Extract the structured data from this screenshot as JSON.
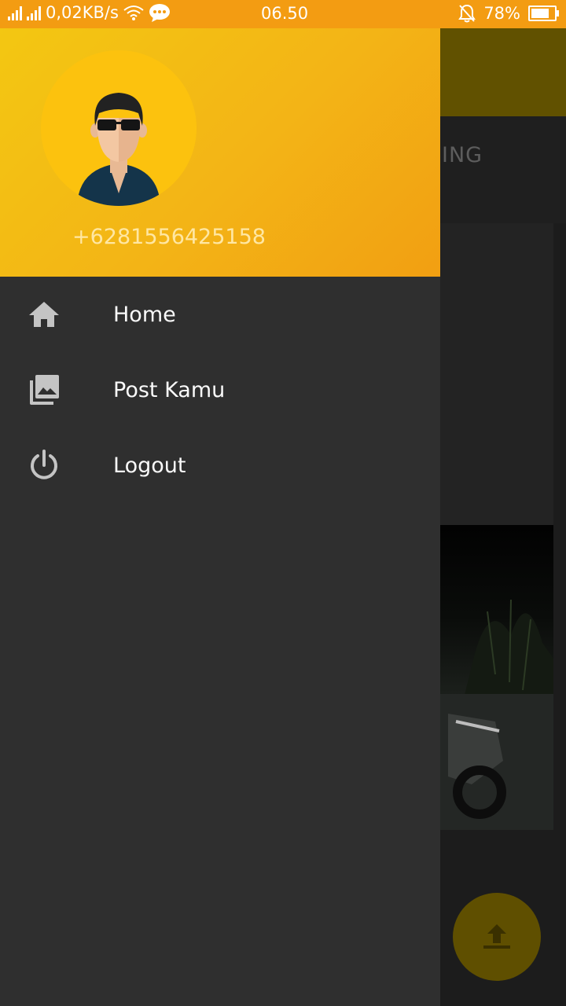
{
  "status_bar": {
    "network_speed": "0,02KB/s",
    "time": "06.50",
    "battery": "78%",
    "battery_level": 0.78
  },
  "background": {
    "tab_partial_label": "ING"
  },
  "drawer": {
    "phone": "+6281556425158",
    "items": [
      {
        "label": "Home",
        "icon": "home-icon"
      },
      {
        "label": "Post Kamu",
        "icon": "photo-library-icon"
      },
      {
        "label": "Logout",
        "icon": "power-icon"
      }
    ]
  },
  "colors": {
    "status_bar": "#f39c12",
    "header_start": "#f3c712",
    "header_end": "#f29f12",
    "drawer_bg": "#2f2f2f",
    "fab_dimmed": "#5f4f00"
  }
}
